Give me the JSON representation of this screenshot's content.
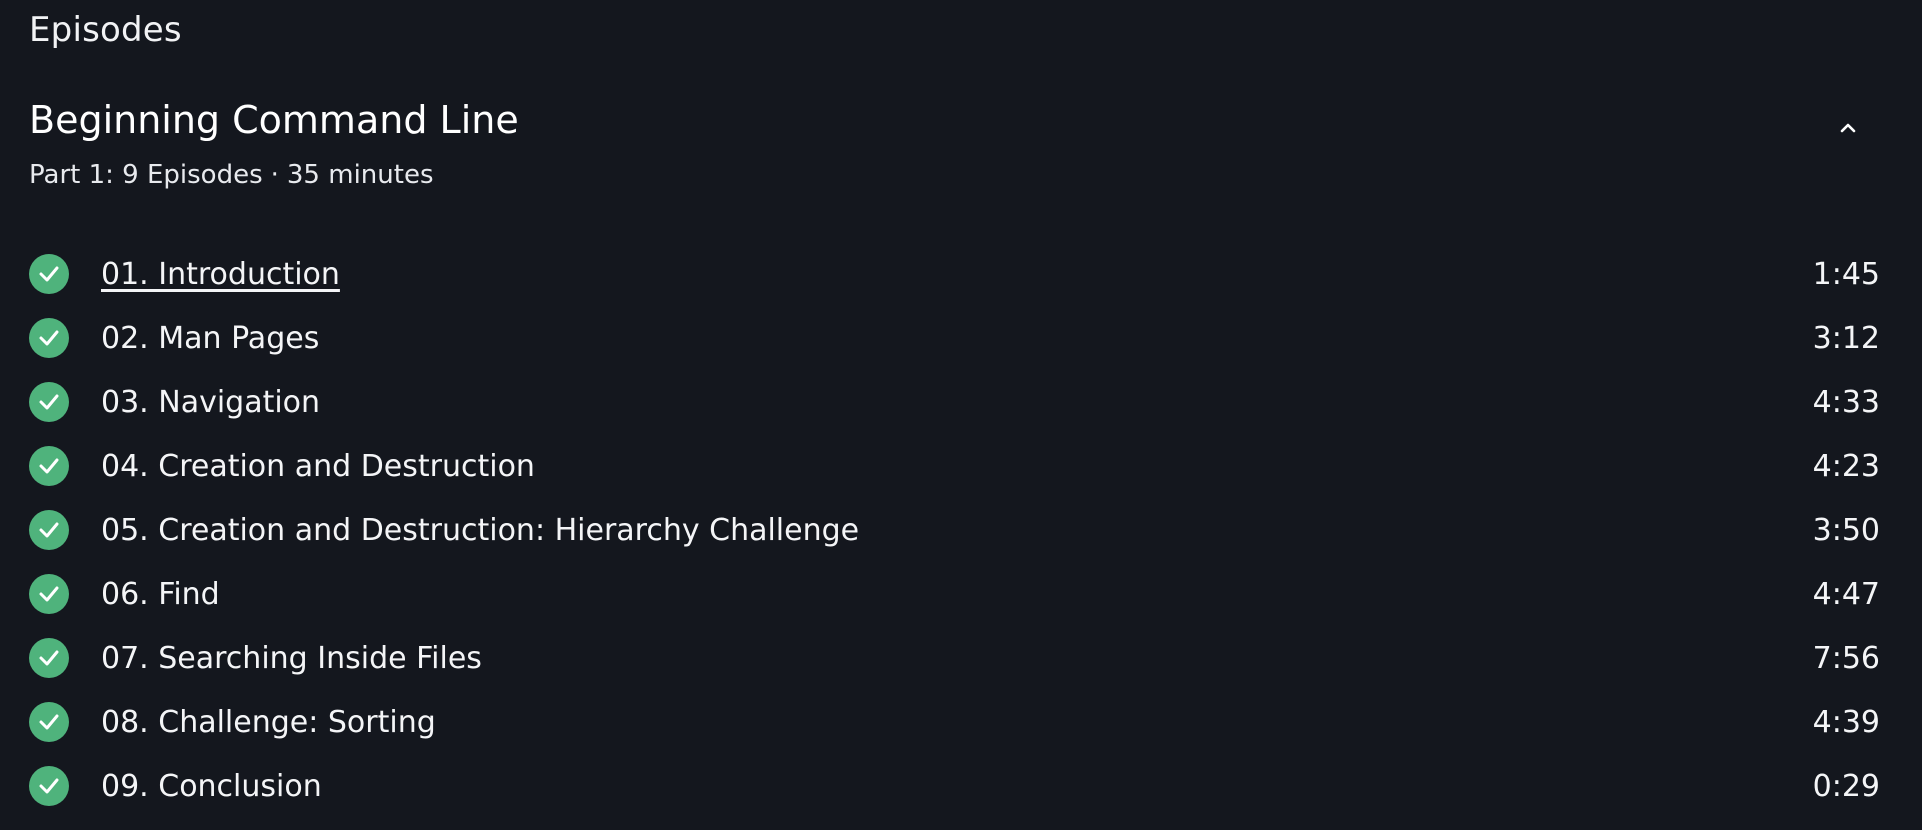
{
  "header": {
    "title": "Episodes"
  },
  "course": {
    "title": "Beginning Command Line",
    "part": "Part 1: 9 Episodes",
    "separator": "·",
    "length": "35 minutes",
    "collapse_icon": "chevron-up-icon"
  },
  "colors": {
    "background": "#14171e",
    "completed": "#4fb37c",
    "text": "#ffffff"
  },
  "episodes": [
    {
      "title": "01. Introduction",
      "duration": "1:45",
      "completed": true,
      "current": true
    },
    {
      "title": "02. Man Pages",
      "duration": "3:12",
      "completed": true,
      "current": false
    },
    {
      "title": "03. Navigation",
      "duration": "4:33",
      "completed": true,
      "current": false
    },
    {
      "title": "04. Creation and Destruction",
      "duration": "4:23",
      "completed": true,
      "current": false
    },
    {
      "title": "05. Creation and Destruction: Hierarchy Challenge",
      "duration": "3:50",
      "completed": true,
      "current": false
    },
    {
      "title": "06. Find",
      "duration": "4:47",
      "completed": true,
      "current": false
    },
    {
      "title": "07. Searching Inside Files",
      "duration": "7:56",
      "completed": true,
      "current": false
    },
    {
      "title": "08. Challenge: Sorting",
      "duration": "4:39",
      "completed": true,
      "current": false
    },
    {
      "title": "09. Conclusion",
      "duration": "0:29",
      "completed": true,
      "current": false
    }
  ]
}
